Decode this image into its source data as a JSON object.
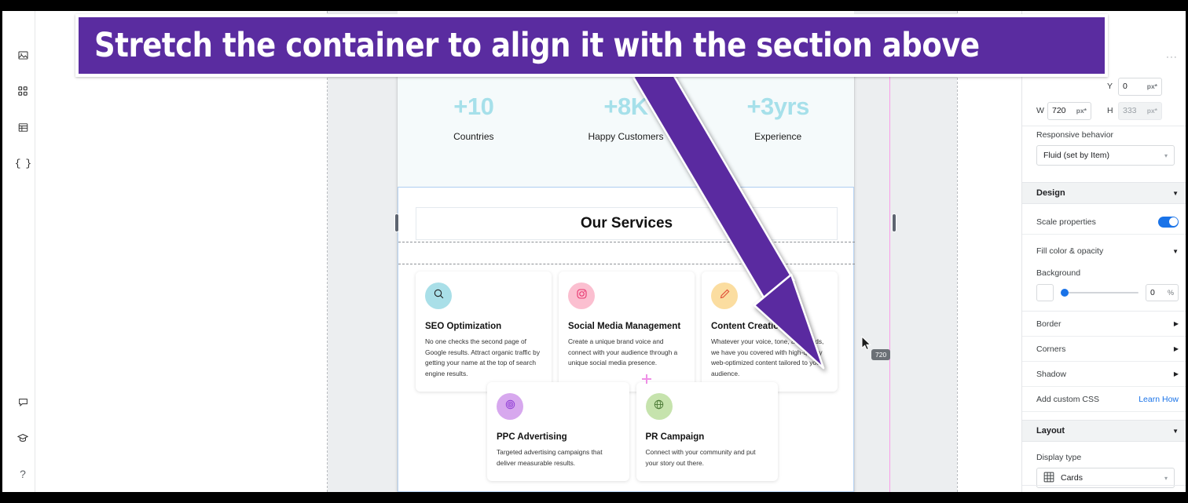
{
  "annotation": {
    "text": "Stretch the container to align it with the section above",
    "banner_bg": "#5a2ca0",
    "arrow_color": "#5a2ca0"
  },
  "left_rail": {
    "top_items": [
      {
        "icon": "image-icon",
        "name": "media"
      },
      {
        "icon": "grid-apps-icon",
        "name": "apps"
      },
      {
        "icon": "table-icon",
        "name": "database"
      },
      {
        "icon": "code-braces-icon",
        "name": "dev-mode"
      }
    ],
    "bottom_items": [
      {
        "icon": "comment-icon",
        "name": "comments"
      },
      {
        "icon": "graduation-cap-icon",
        "name": "learn"
      },
      {
        "icon": "question-mark-icon",
        "name": "help",
        "glyph": "?"
      }
    ]
  },
  "canvas": {
    "stats": [
      {
        "value": "+10",
        "label": "Countries"
      },
      {
        "value": "+8K",
        "label": "Happy Customers"
      },
      {
        "value": "+3yrs",
        "label": "Experience"
      }
    ],
    "stats_color": "#a6e0ea",
    "section_title": "Our Services",
    "services_row1": [
      {
        "title": "SEO Optimization",
        "desc": "No one checks the second page of Google results. Attract organic traffic by getting your name at the top of search engine results.",
        "icon": "magnifier-icon",
        "icon_bg": "#a9dfe8",
        "icon_color": "#1b1b1b"
      },
      {
        "title": "Social Media Management",
        "desc": "Create a unique brand voice and connect with your audience through a unique social media presence.",
        "icon": "instagram-icon",
        "icon_bg": "#fbbfd0",
        "icon_color": "#e8336d"
      },
      {
        "title": "Content Creation",
        "desc": "Whatever your voice, tone, and needs, we have you covered with high-quality web-optimized content tailored to your audience.",
        "icon": "pencil-icon",
        "icon_bg": "#fbdda0",
        "icon_color": "#e0503a"
      }
    ],
    "services_row2": [
      {
        "title": "PPC Advertising",
        "desc": "Targeted advertising campaigns that deliver measurable results.",
        "icon": "target-icon",
        "icon_bg": "#d7a8ee",
        "icon_color": "#8e3bd4"
      },
      {
        "title": "PR Campaign",
        "desc": "Connect with your community and put your story out there.",
        "icon": "globe-icon",
        "icon_bg": "#c6e3ad",
        "icon_color": "#4c7a36"
      }
    ],
    "size_tooltip": "720",
    "selection_guide_color": "#f99de8"
  },
  "right_panel": {
    "kebab": "···",
    "dimensions": {
      "y_label": "Y",
      "y_value": "0",
      "y_unit": "px*",
      "x_hidden": true,
      "w_label": "W",
      "w_value": "720",
      "w_unit": "px*",
      "h_label": "H",
      "h_value": "333",
      "h_unit": "px*"
    },
    "responsive": {
      "label": "Responsive behavior",
      "value": "Fluid (set by Item)"
    },
    "design_section": {
      "title": "Design",
      "scale_properties_label": "Scale properties",
      "scale_properties_on": true,
      "fill_label": "Fill color & opacity",
      "background_label": "Background",
      "background_opacity": "0",
      "background_unit": "%",
      "border_label": "Border",
      "corners_label": "Corners",
      "shadow_label": "Shadow",
      "custom_css_label": "Add custom CSS",
      "learn_how_label": "Learn How",
      "accent_color": "#1a73e8"
    },
    "layout_section": {
      "title": "Layout",
      "display_type_label": "Display type",
      "display_type_value": "Cards",
      "display_type_icon": "grid-table-icon"
    }
  }
}
